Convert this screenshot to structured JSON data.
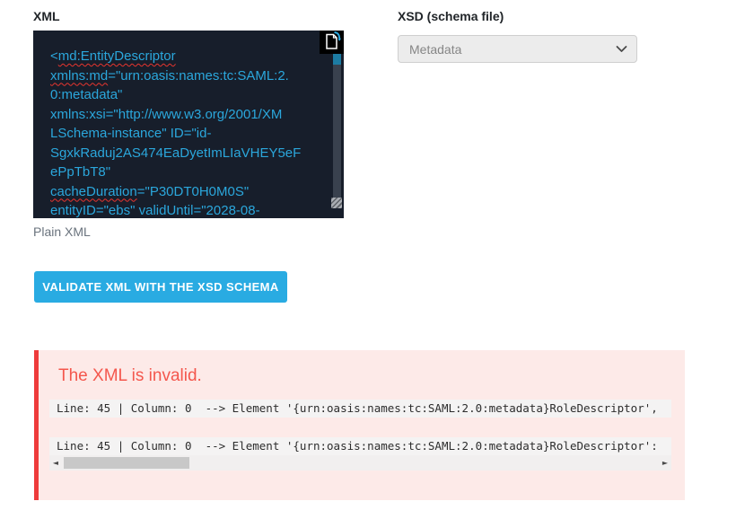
{
  "labels": {
    "xml": "XML",
    "xsd": "XSD (schema file)",
    "plain_xml": "Plain XML"
  },
  "xsd_select": {
    "selected": "Metadata"
  },
  "validate_button": {
    "label": "VALIDATE XML WITH THE XSD SCHEMA"
  },
  "editor": {
    "lines": [
      {
        "pre": "<",
        "wavy": "md:EntityDescriptor",
        "post": ""
      },
      {
        "pre": "",
        "wavy": "xmlns:md",
        "post": "=\"urn:oasis:names:tc:SAML:2."
      },
      {
        "pre": "0:metadata\"",
        "wavy": "",
        "post": ""
      },
      {
        "pre": "xmlns:xsi=\"http://www.w3.org/2001/XM",
        "wavy": "",
        "post": ""
      },
      {
        "pre": "LSchema-instance\" ID=\"id-",
        "wavy": "",
        "post": ""
      },
      {
        "pre": "SgxkRaduj2AS474EaDyetImLIaVHEY5eF",
        "wavy": "",
        "post": ""
      },
      {
        "pre": "ePpTbT8\"",
        "wavy": "",
        "post": ""
      },
      {
        "pre": "",
        "wavy": "cacheDuration",
        "post": "=\"P30DT0H0M0S\""
      },
      {
        "pre": "entityID=\"ebs\" validUntil=\"2028-08-",
        "wavy": "",
        "post": ""
      }
    ]
  },
  "validation": {
    "title": "The XML is invalid.",
    "messages": [
      "Line: 45 | Column: 0  --> Element '{urn:oasis:names:tc:SAML:2.0:metadata}RoleDescriptor',",
      "Line: 45 | Column: 0  --> Element '{urn:oasis:names:tc:SAML:2.0:metadata}RoleDescriptor':"
    ]
  },
  "icons": {
    "copy": "copy-icon",
    "chevron_down": "chevron-down-icon",
    "resize_grip": "resize-grip-icon",
    "scroll_left": "scroll-left-arrow-icon",
    "scroll_right": "scroll-right-arrow-icon",
    "scroll_left_glyph": "◄",
    "scroll_right_glyph": "►"
  },
  "colors": {
    "accent": "#29ABE2",
    "editor_bg": "#171E2B",
    "editor_text": "#2BA7DC",
    "squiggle": "#E8352E",
    "error_bg": "#FDEAE8",
    "error_border": "#EE3B3B",
    "error_title": "#F4574D",
    "scrollbar_thumb_blue": "#1D7CA3"
  }
}
